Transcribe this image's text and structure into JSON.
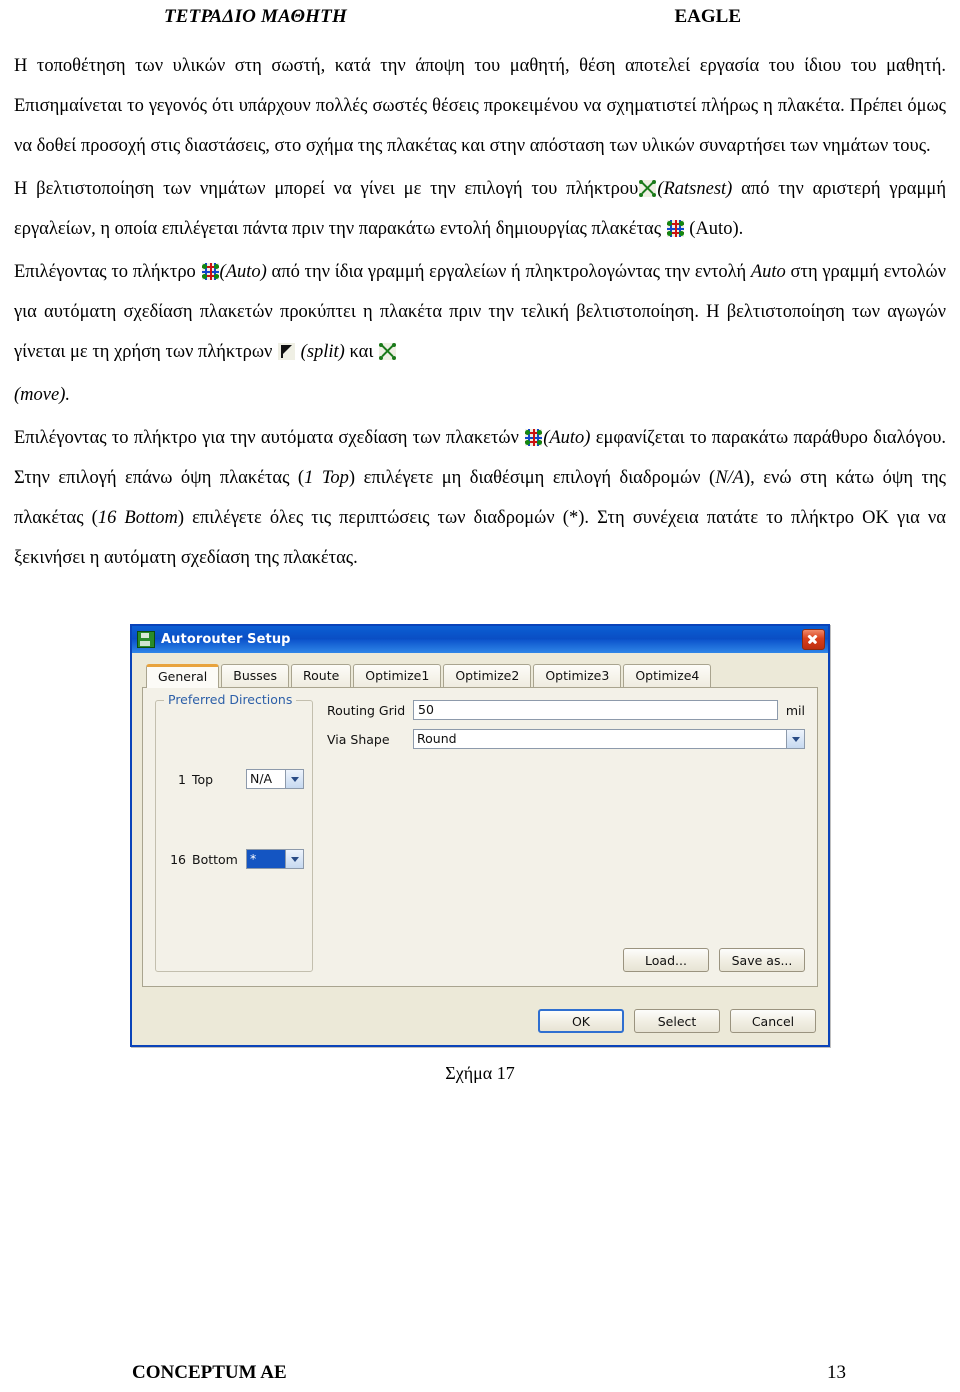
{
  "header": {
    "left": "ΤΕΤΡΑΔΙΟ ΜΑΘΗΤΗ",
    "right": "EAGLE"
  },
  "paragraphs": {
    "p1_a": "Η τοποθέτηση των υλικών στη σωστή, κατά την άποψη του μαθητή, θέση αποτελεί εργασία του ίδιου του μαθητή. Επισημαίνεται το γεγονός ότι υπάρχουν πολλές σωστές θέσεις προκειμένου να σχηματιστεί πλήρως η πλακέτα. Πρέπει όμως να δοθεί προσοχή στις διαστάσεις, στο σχήμα της πλακέτας και στην απόσταση των υλικών συναρτήσει των νημάτων τους.",
    "p2_a": "Η βελτιστοποίηση των νημάτων μπορεί να γίνει με την επιλογή του πλήκτρου",
    "p2_ratsnest": "(Ratsnest)",
    "p2_b": "από την αριστερή γραμμή εργαλείων, η οποία επιλέγεται πάντα πριν την παρακάτω εντολή δημιουργίας πλακέτας",
    "p2_auto": "(Auto).",
    "p3_a": "Επιλέγοντας το πλήκτρο",
    "p3_auto": "(Auto)",
    "p3_b": "από την ίδια γραμμή εργαλείων ή πληκτρολογώντας την εντολή",
    "p3_cmd": "Auto",
    "p3_c": "στη γραμμή εντολών για αυτόματη σχεδίαση πλακετών προκύπτει η πλακέτα πριν την τελική βελτιστοποίηση. Η βελτιστοποίηση των αγωγών γίνεται με τη χρήση των πλήκτρων",
    "p3_split": "(split)",
    "p3_d": "και",
    "p3_move": "(move).",
    "p4_a": "Επιλέγοντας το πλήκτρο για την αυτόματα σχεδίαση των πλακετών",
    "p4_auto": "(Auto)",
    "p4_b": "εμφανίζεται το παρακάτω παράθυρο διαλόγου. Στην επιλογή επάνω όψη πλακέτας (",
    "p4_top": "1 Top",
    "p4_c": ") επιλέγετε μη διαθέσιμη επιλογή διαδρομών (",
    "p4_na": "N/A",
    "p4_d": "), ενώ στη κάτω όψη της πλακέτας  (",
    "p4_bottom": "16 Bottom",
    "p4_e": ") επιλέγετε όλες τις περιπτώσεις των διαδρομών (*). Στη συνέχεια πατάτε το πλήκτρο ΟΚ για να ξεκινήσει η αυτόματη σχεδίαση της πλακέτας."
  },
  "dialog": {
    "title": "Autorouter Setup",
    "icon": "floppy-save-icon",
    "close_label": "×",
    "tabs": [
      {
        "label": "General",
        "active": true
      },
      {
        "label": "Busses",
        "active": false
      },
      {
        "label": "Route",
        "active": false
      },
      {
        "label": "Optimize1",
        "active": false
      },
      {
        "label": "Optimize2",
        "active": false
      },
      {
        "label": "Optimize3",
        "active": false
      },
      {
        "label": "Optimize4",
        "active": false
      }
    ],
    "groupbox": {
      "legend": "Preferred Directions",
      "layers": [
        {
          "num": "1",
          "name": "Top",
          "value": "N/A",
          "selected": false
        },
        {
          "num": "16",
          "name": "Bottom",
          "value": "*",
          "selected": true
        }
      ]
    },
    "fields": {
      "routing_grid_label": "Routing Grid",
      "routing_grid_value": "50",
      "routing_grid_unit": "mil",
      "via_shape_label": "Via Shape",
      "via_shape_value": "Round"
    },
    "panel_buttons": {
      "load": "Load...",
      "save_as": "Save as..."
    },
    "footer_buttons": {
      "ok": "OK",
      "select": "Select",
      "cancel": "Cancel"
    },
    "colors": {
      "titlebar": "#0a4ec4",
      "close": "#d8401c",
      "active_tab_accent": "#e8a33d",
      "legend_text": "#2c5fa8",
      "selection": "#1455c2",
      "dialog_face": "#ece9d8"
    }
  },
  "figure_caption": "Σχήμα 17",
  "footer": {
    "left": "CONCEPTUM AE",
    "right": "13"
  }
}
